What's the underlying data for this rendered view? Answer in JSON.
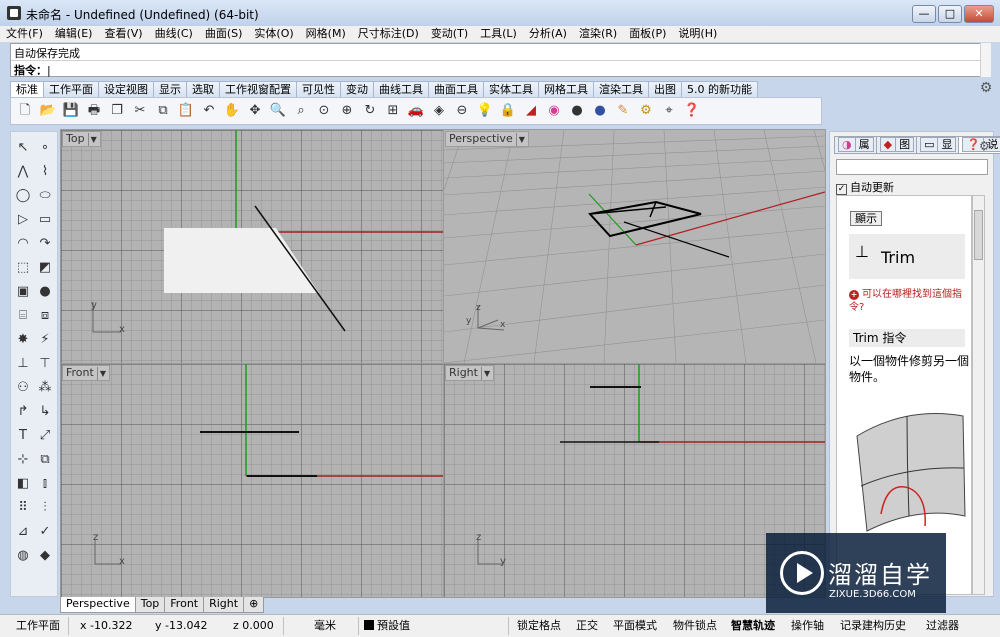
{
  "window": {
    "title": "未命名 - Undefined (Undefined) (64-bit)",
    "minimize": "—",
    "maximize": "□",
    "close": "✕"
  },
  "menu": [
    "文件(F)",
    "编辑(E)",
    "查看(V)",
    "曲线(C)",
    "曲面(S)",
    "实体(O)",
    "网格(M)",
    "尺寸标注(D)",
    "变动(T)",
    "工具(L)",
    "分析(A)",
    "渲染(R)",
    "面板(P)",
    "说明(H)"
  ],
  "command": {
    "history": "自动保存完成",
    "prompt": "指令：",
    "input": "|"
  },
  "tabs": [
    "标准",
    "工作平面",
    "设定视图",
    "显示",
    "选取",
    "工作视窗配置",
    "可见性",
    "变动",
    "曲线工具",
    "曲面工具",
    "实体工具",
    "网格工具",
    "渲染工具",
    "出图",
    "5.0 的新功能"
  ],
  "active_tab": "标准",
  "toolbar_icons": [
    "new-file-icon",
    "open-file-icon",
    "save-icon",
    "print-icon",
    "import-icon",
    "cut-icon",
    "copy-icon",
    "paste-icon",
    "undo-icon",
    "pan-hand-icon",
    "rotate-view-icon",
    "zoom-icon",
    "zoom-window-icon",
    "zoom-extents-icon",
    "zoom-selected-icon",
    "grid-4view-icon",
    "car-icon",
    "layer-icon",
    "snap-icon",
    "bulb-icon",
    "lock-icon",
    "material-icon",
    "color-wheel-icon",
    "render-sphere-icon",
    "environment-sphere-icon",
    "pen-icon",
    "settings-gear-icon",
    "gumball-icon",
    "help-icon"
  ],
  "viewports": {
    "top": "Top",
    "perspective": "Perspective",
    "front": "Front",
    "right": "Right"
  },
  "axis_labels": {
    "x": "x",
    "y": "y",
    "z": "z"
  },
  "right_panel": {
    "tabs": [
      "属",
      "图",
      "显",
      "说"
    ],
    "auto_update": "自动更新",
    "show_button": "顯示",
    "command_name": "Trim",
    "question": "可以在哪裡找到這個指令?",
    "heading": "Trim 指令",
    "description": "以一個物件修剪另一個物件。"
  },
  "viewport_tabs": [
    "Perspective",
    "Top",
    "Front",
    "Right",
    "⊕"
  ],
  "active_viewport_tab": "Perspective",
  "status": {
    "cplane": "工作平面",
    "x": "x -10.322",
    "y": "y -13.042",
    "z": "z 0.000",
    "units": "毫米",
    "layer": "預設值",
    "snap": "锁定格点",
    "ortho": "正交",
    "planar": "平面模式",
    "osnap": "物件锁点",
    "smarttrack": "智慧轨迹",
    "gumball": "操作轴",
    "history": "记录建构历史",
    "filter": "过滤器"
  },
  "watermark": {
    "name": "溜溜自学",
    "url": "ZIXUE.3D66.COM"
  }
}
